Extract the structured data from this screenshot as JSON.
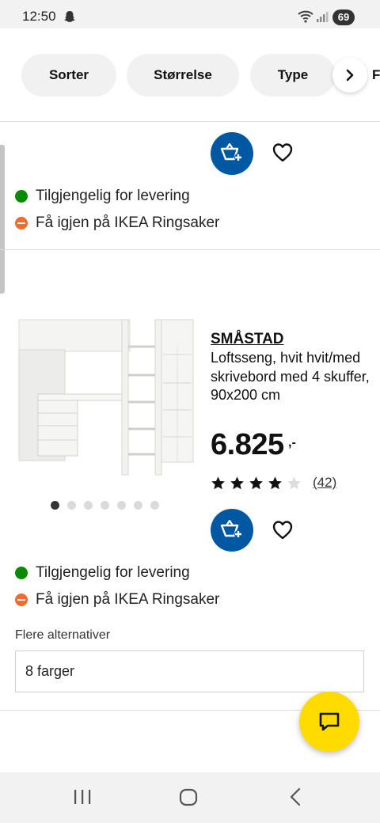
{
  "status_bar": {
    "time": "12:50",
    "battery": "69",
    "icons": [
      "ghost-icon",
      "wifi-icon",
      "signal-icon",
      "battery-icon"
    ]
  },
  "filters": {
    "chips": [
      "Sorter",
      "Størrelse",
      "Type"
    ],
    "partial_chip": "F",
    "next_icon": "chevron-right-icon"
  },
  "previous_item": {
    "availability": [
      {
        "text": "Tilgjengelig for levering",
        "status": "available"
      },
      {
        "text": "Få igjen på IKEA Ringsaker",
        "status": "unavailable"
      }
    ]
  },
  "product": {
    "name": "SMÅSTAD",
    "description": "Loftsseng, hvit hvit/med skrivebord med 4 skuffer, 90x200 cm",
    "price": "6.825",
    "price_suffix": ",-",
    "rating": 4,
    "rating_max": 5,
    "review_count": "(42)",
    "image_count": 7,
    "active_image": 1,
    "availability": [
      {
        "text": "Tilgjengelig for levering",
        "status": "available"
      },
      {
        "text": "Få igjen på IKEA Ringsaker",
        "status": "unavailable"
      }
    ],
    "alternatives_label": "Flere alternativer",
    "alternatives_value": "8 farger"
  },
  "colors": {
    "cart_button": "#0058a3",
    "available": "#0a8a00",
    "unavailable": "#f26a2e",
    "chat_fab": "#ffdb00"
  },
  "nav_icons": [
    "recent-apps-icon",
    "home-icon",
    "back-icon"
  ]
}
